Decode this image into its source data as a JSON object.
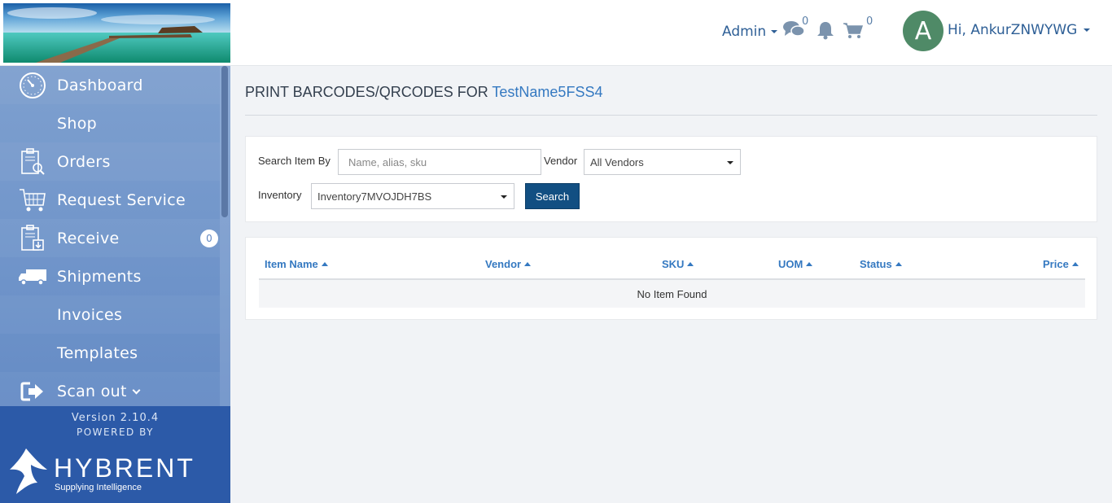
{
  "header": {
    "admin_label": "Admin",
    "messages_count": "0",
    "cart_count": "0",
    "avatar_letter": "A",
    "greeting": "Hi, AnkurZNWYWG"
  },
  "sidebar": {
    "items": [
      {
        "label": "Dashboard",
        "icon": "dashboard-icon"
      },
      {
        "label": "Shop",
        "icon": ""
      },
      {
        "label": "Orders",
        "icon": "orders-icon"
      },
      {
        "label": "Request Service",
        "icon": "request-service-icon"
      },
      {
        "label": "Receive",
        "icon": "receive-icon",
        "badge": "0"
      },
      {
        "label": "Shipments",
        "icon": "truck-icon"
      },
      {
        "label": "Invoices",
        "icon": ""
      },
      {
        "label": "Templates",
        "icon": ""
      },
      {
        "label": "Scan out",
        "icon": "scan-out-icon"
      }
    ],
    "version": "Version 2.10.4",
    "powered_by": "POWERED BY",
    "brand_name": "HYBRENT",
    "brand_tagline": "Supplying Intelligence"
  },
  "page": {
    "title_prefix": "PRINT BARCODES/QRCODES FOR",
    "title_accent": "TestName5FSS4"
  },
  "search": {
    "search_by_label": "Search Item By",
    "search_placeholder": "Name, alias, sku",
    "vendor_label": "Vendor",
    "vendor_selected": "All Vendors",
    "inventory_label": "Inventory",
    "inventory_selected": "Inventory7MVOJDH7BS",
    "search_button": "Search"
  },
  "table": {
    "columns": [
      "Item Name",
      "Vendor",
      "SKU",
      "UOM",
      "Status",
      "Price"
    ],
    "empty_message": "No Item Found"
  },
  "colors": {
    "sidebar": "#6e93c9",
    "sidebar_footer": "#2c5aa8",
    "accent": "#3579c1",
    "search_button": "#124f82",
    "avatar": "#4f8a67"
  }
}
